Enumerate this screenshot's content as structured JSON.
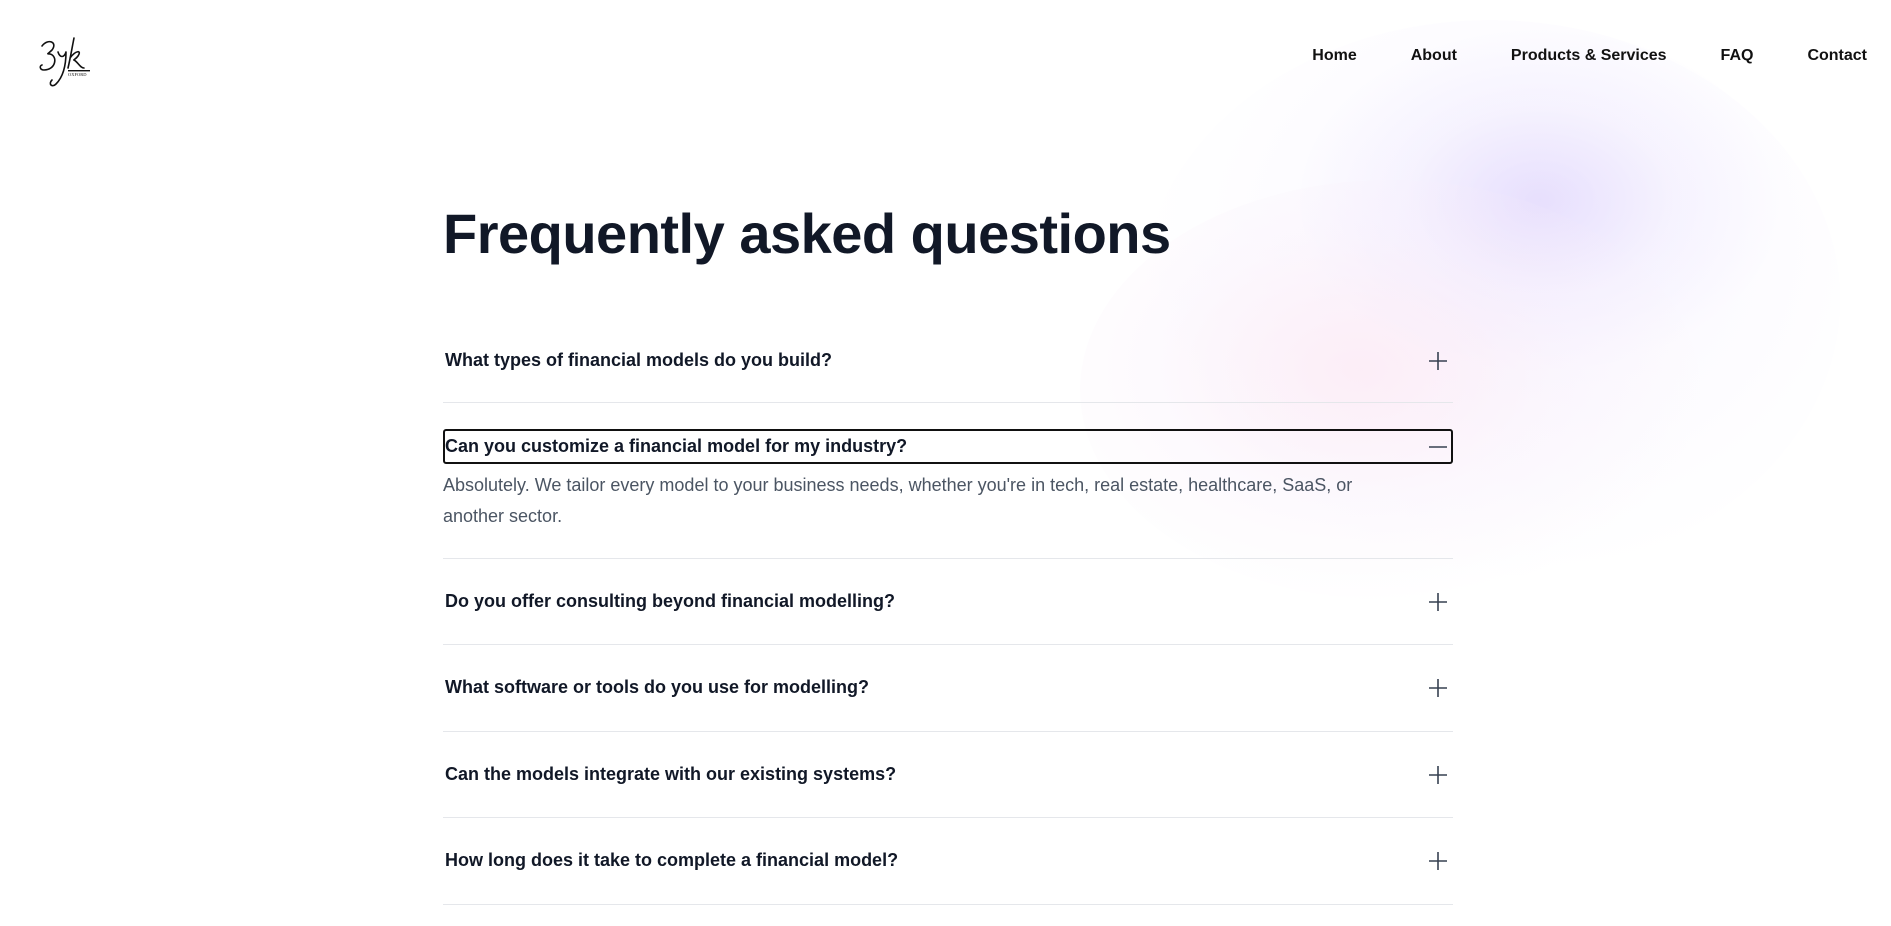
{
  "header": {
    "logo_alt": "3yk OXFORD",
    "nav": [
      {
        "label": "Home"
      },
      {
        "label": "About"
      },
      {
        "label": "Products & Services"
      },
      {
        "label": "FAQ"
      },
      {
        "label": "Contact"
      }
    ]
  },
  "main": {
    "title": "Frequently asked questions",
    "faqs": [
      {
        "question": "What types of financial models do you build?",
        "expanded": false,
        "icon": "plus-icon"
      },
      {
        "question": "Can you customize a financial model for my industry?",
        "expanded": true,
        "icon": "minus-icon",
        "answer": "Absolutely. We tailor every model to your business needs, whether you're in tech, real estate, healthcare, SaaS, or another sector."
      },
      {
        "question": "Do you offer consulting beyond financial modelling?",
        "expanded": false,
        "icon": "plus-icon"
      },
      {
        "question": "What software or tools do you use for modelling?",
        "expanded": false,
        "icon": "plus-icon"
      },
      {
        "question": "Can the models integrate with our existing systems?",
        "expanded": false,
        "icon": "plus-icon"
      },
      {
        "question": "How long does it take to complete a financial model?",
        "expanded": false,
        "icon": "plus-icon"
      }
    ]
  },
  "colors": {
    "text": "#111827",
    "answer_text": "#4b5563",
    "divider": "#e5e7eb",
    "glow_lavender": "#ddd2fc",
    "glow_pink": "#fce2f0"
  }
}
